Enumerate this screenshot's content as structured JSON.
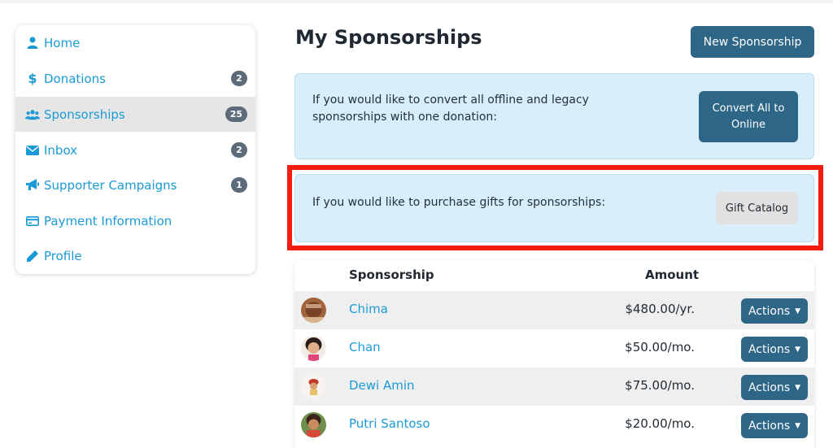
{
  "sidebar": {
    "items": [
      {
        "label": "Home",
        "icon": "user-icon",
        "badge": ""
      },
      {
        "label": "Donations",
        "icon": "dollar-icon",
        "badge": "2"
      },
      {
        "label": "Sponsorships",
        "icon": "users-icon",
        "badge": "25",
        "active": true
      },
      {
        "label": "Inbox",
        "icon": "envelope-icon",
        "badge": "2"
      },
      {
        "label": "Supporter Campaigns",
        "icon": "megaphone-icon",
        "badge": "1"
      },
      {
        "label": "Payment Information",
        "icon": "credit-card-icon",
        "badge": ""
      },
      {
        "label": "Profile",
        "icon": "pencil-icon",
        "badge": ""
      }
    ]
  },
  "main": {
    "title": "My Sponsorships",
    "new_button": "New Sponsorship",
    "convert_panel": {
      "text_line1": "If you would like to convert all offline and legacy",
      "text_line2": "sponsorships with one donation:",
      "button_line1": "Convert All to",
      "button_line2": "Online"
    },
    "gift_panel": {
      "text": "If you would like to purchase gifts for sponsorships:",
      "button": "Gift Catalog"
    },
    "table": {
      "headers": {
        "sponsorship": "Sponsorship",
        "amount": "Amount"
      },
      "rows": [
        {
          "name": "Chima",
          "amount": "$480.00/yr.",
          "action": "Actions"
        },
        {
          "name": "Chan",
          "amount": "$50.00/mo.",
          "action": "Actions"
        },
        {
          "name": "Dewi Amin",
          "amount": "$75.00/mo.",
          "action": "Actions"
        },
        {
          "name": "Putri Santoso",
          "amount": "$20.00/mo.",
          "action": "Actions"
        }
      ]
    }
  },
  "colors": {
    "accent": "#1a9ad6",
    "button": "#2e6688",
    "panel": "#d8eefb",
    "highlight": "#f41b0f",
    "badge": "#5b6b7a"
  }
}
